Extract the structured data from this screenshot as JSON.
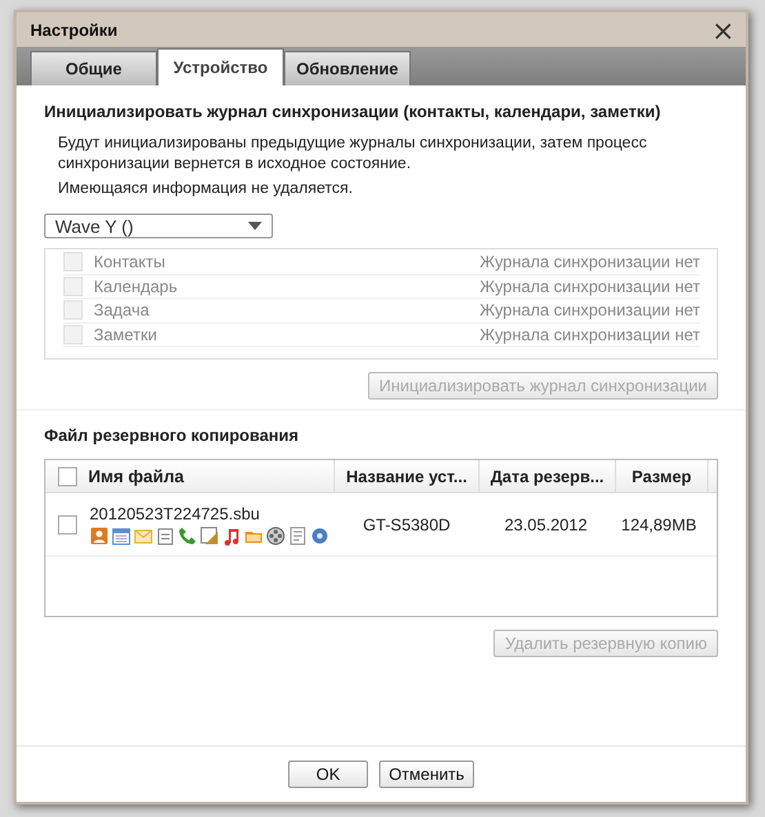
{
  "dialog": {
    "title": "Настройки",
    "close": "×"
  },
  "tabs": [
    {
      "label": "Общие",
      "selected": false
    },
    {
      "label": "Устройство",
      "selected": true
    },
    {
      "label": "Обновление",
      "selected": false
    }
  ],
  "sync": {
    "heading": "Инициализировать журнал синхронизации (контакты, календари, заметки)",
    "description": "Будут инициализированы предыдущие журналы синхронизации, затем процесс синхронизации вернется в исходное состояние.",
    "note": "Имеющаяся информация не удаляется.",
    "device_select": "Wave Y ()",
    "items": [
      {
        "label": "Контакты",
        "status": "Журнала синхронизации нет",
        "checked": false,
        "disabled": true
      },
      {
        "label": "Календарь",
        "status": "Журнала синхронизации нет",
        "checked": false,
        "disabled": true
      },
      {
        "label": "Задача",
        "status": "Журнала синхронизации нет",
        "checked": false,
        "disabled": true
      },
      {
        "label": "Заметки",
        "status": "Журнала синхронизации нет",
        "checked": false,
        "disabled": true
      }
    ],
    "button": {
      "label": "Инициализировать журнал синхронизации",
      "disabled": true
    }
  },
  "backup": {
    "heading": "Файл резервного копирования",
    "select_all_checked": false,
    "columns": [
      "Имя файла",
      "Название уст...",
      "Дата резерв...",
      "Размер"
    ],
    "rows": [
      {
        "file": "20120523T224725.sbu",
        "device": "GT-S5380D",
        "date": "23.05.2012",
        "size": "124,89MB",
        "checked": false
      }
    ],
    "button": {
      "label": "Удалить резервную копию",
      "disabled": true
    }
  },
  "buttons": [
    {
      "label": "OK"
    },
    {
      "label": "Отменить"
    }
  ]
}
